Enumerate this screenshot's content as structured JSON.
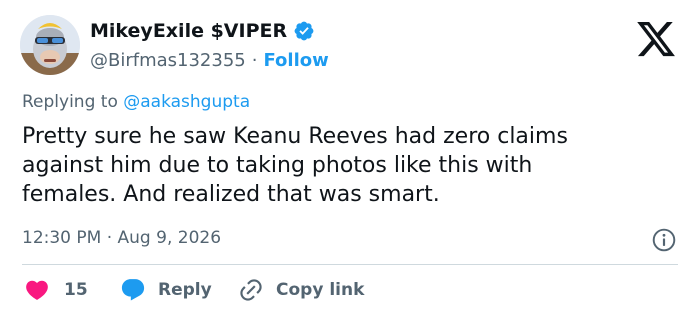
{
  "colors": {
    "text_primary": "#0f1419",
    "text_secondary": "#536471",
    "accent_blue": "#1d9bf0",
    "like_pink": "#f91880",
    "divider": "#cfd9de"
  },
  "author": {
    "display_name": "MikeyExile $VIPER",
    "verified_icon": "verified-badge-icon",
    "handle": "@Birfmas132355",
    "separator": "·",
    "follow_label": "Follow",
    "avatar_icon": "ape-avatar"
  },
  "brand": {
    "logo_icon": "x-logo-icon"
  },
  "replying": {
    "prefix": "Replying to",
    "handle": "@aakashgupta"
  },
  "tweet": {
    "lines": [
      "Pretty sure he saw Keanu Reeves had zero claims",
      "against him due to taking photos like this with",
      "females. And realized that was smart."
    ]
  },
  "meta": {
    "timestamp": "12:30 PM · Aug 9, 2026",
    "info_icon": "info-icon"
  },
  "actions": {
    "like_count": "15",
    "like_icon": "heart-icon",
    "reply_label": "Reply",
    "reply_icon": "speech-bubble-icon",
    "copy_label": "Copy link",
    "copy_icon": "link-icon"
  }
}
